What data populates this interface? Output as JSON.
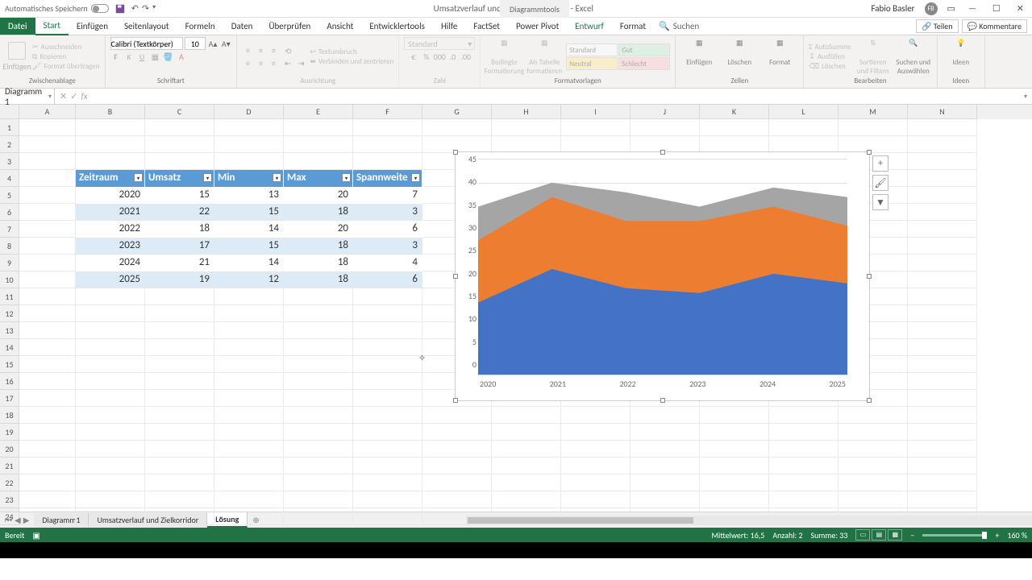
{
  "titlebar": {
    "autosave_label": "Automatisches Speichern",
    "doc_title": "Umsatzverlauf und Zielkorridor Grafik - Excel",
    "tool_context": "Diagrammtools",
    "username": "Fabio Basler",
    "user_initials": "FB"
  },
  "ribbon_tabs": {
    "file": "Datei",
    "start": "Start",
    "einfuegen": "Einfügen",
    "seitenlayout": "Seitenlayout",
    "formeln": "Formeln",
    "daten": "Daten",
    "ueberpruefen": "Überprüfen",
    "ansicht": "Ansicht",
    "entwicklertools": "Entwicklertools",
    "hilfe": "Hilfe",
    "factset": "FactSet",
    "powerpivot": "Power Pivot",
    "entwurf": "Entwurf",
    "format": "Format",
    "suchen": "Suchen",
    "teilen": "Teilen",
    "kommentare": "Kommentare"
  },
  "ribbon": {
    "clipboard": {
      "einfuegen_label": "Einfügen",
      "ausschneiden": "Ausschneiden",
      "kopieren": "Kopieren",
      "format_uebertragen": "Format übertragen",
      "group": "Zwischenablage"
    },
    "font": {
      "name": "Calibri (Textkörper)",
      "size": "10",
      "group": "Schriftart"
    },
    "alignment": {
      "textumbruch": "Textumbruch",
      "verbinden": "Verbinden und zentrieren",
      "group": "Ausrichtung"
    },
    "number": {
      "format": "Standard",
      "group": "Zahl"
    },
    "styles": {
      "bedingte": "Bedingte Formatierung",
      "alstabelle": "Als Tabelle formatieren",
      "standard": "Standard",
      "gut": "Gut",
      "neutral": "Neutral",
      "schlecht": "Schlecht",
      "group": "Formatvorlagen"
    },
    "cells": {
      "einfuegen": "Einfügen",
      "loeschen": "Löschen",
      "format": "Format",
      "group": "Zellen"
    },
    "editing": {
      "autosumme": "AutoSumme",
      "ausfuellen": "Ausfüllen",
      "loeschen": "Löschen",
      "sortieren": "Sortieren und Filtern",
      "suchen": "Suchen und Auswählen",
      "group": "Bearbeiten"
    },
    "ideen": {
      "label": "Ideen",
      "group": "Ideen"
    }
  },
  "namebox": "Diagramm 1",
  "table": {
    "headers": {
      "zeitraum": "Zeitraum",
      "umsatz": "Umsatz",
      "min": "Min",
      "max": "Max",
      "spannweite": "Spannweite"
    },
    "rows": [
      {
        "zeitraum": "2020",
        "umsatz": "15",
        "min": "13",
        "max": "20",
        "spannweite": "7"
      },
      {
        "zeitraum": "2021",
        "umsatz": "22",
        "min": "15",
        "max": "18",
        "spannweite": "3"
      },
      {
        "zeitraum": "2022",
        "umsatz": "18",
        "min": "14",
        "max": "20",
        "spannweite": "6"
      },
      {
        "zeitraum": "2023",
        "umsatz": "17",
        "min": "15",
        "max": "18",
        "spannweite": "3"
      },
      {
        "zeitraum": "2024",
        "umsatz": "21",
        "min": "14",
        "max": "18",
        "spannweite": "4"
      },
      {
        "zeitraum": "2025",
        "umsatz": "19",
        "min": "12",
        "max": "18",
        "spannweite": "6"
      }
    ]
  },
  "chart_data": {
    "type": "area",
    "title": "",
    "xlabel": "",
    "ylabel": "",
    "categories": [
      "2020",
      "2021",
      "2022",
      "2023",
      "2024",
      "2025"
    ],
    "ylim": [
      0,
      45
    ],
    "yticks": [
      0,
      5,
      10,
      15,
      20,
      25,
      30,
      35,
      40,
      45
    ],
    "series": [
      {
        "name": "Umsatz",
        "color": "#4472c4",
        "values": [
          15,
          22,
          18,
          17,
          21,
          19
        ]
      },
      {
        "name": "Min",
        "color": "#ed7d31",
        "values": [
          13,
          15,
          14,
          15,
          14,
          12
        ]
      },
      {
        "name": "Spannweite",
        "color": "#a5a5a5",
        "values": [
          7,
          3,
          6,
          3,
          4,
          6
        ]
      }
    ],
    "stacked_layers": [
      {
        "name": "Umsatz",
        "color": "#4472c4",
        "cum": [
          15,
          22,
          18,
          17,
          21,
          19
        ]
      },
      {
        "name": "Min",
        "color": "#ed7d31",
        "cum": [
          28,
          37,
          32,
          32,
          35,
          31
        ]
      },
      {
        "name": "Spannweite",
        "color": "#a5a5a5",
        "cum": [
          35,
          40,
          38,
          35,
          39,
          37
        ]
      }
    ]
  },
  "sheets": {
    "s1": "Diagramm1",
    "s2": "Umsatzverlauf und Zielkorridor",
    "s3": "Lösung"
  },
  "status": {
    "bereit": "Bereit",
    "mittelwert": "Mittelwert: 16,5",
    "anzahl": "Anzahl: 2",
    "summe": "Summe: 33",
    "zoom": "160 %"
  }
}
